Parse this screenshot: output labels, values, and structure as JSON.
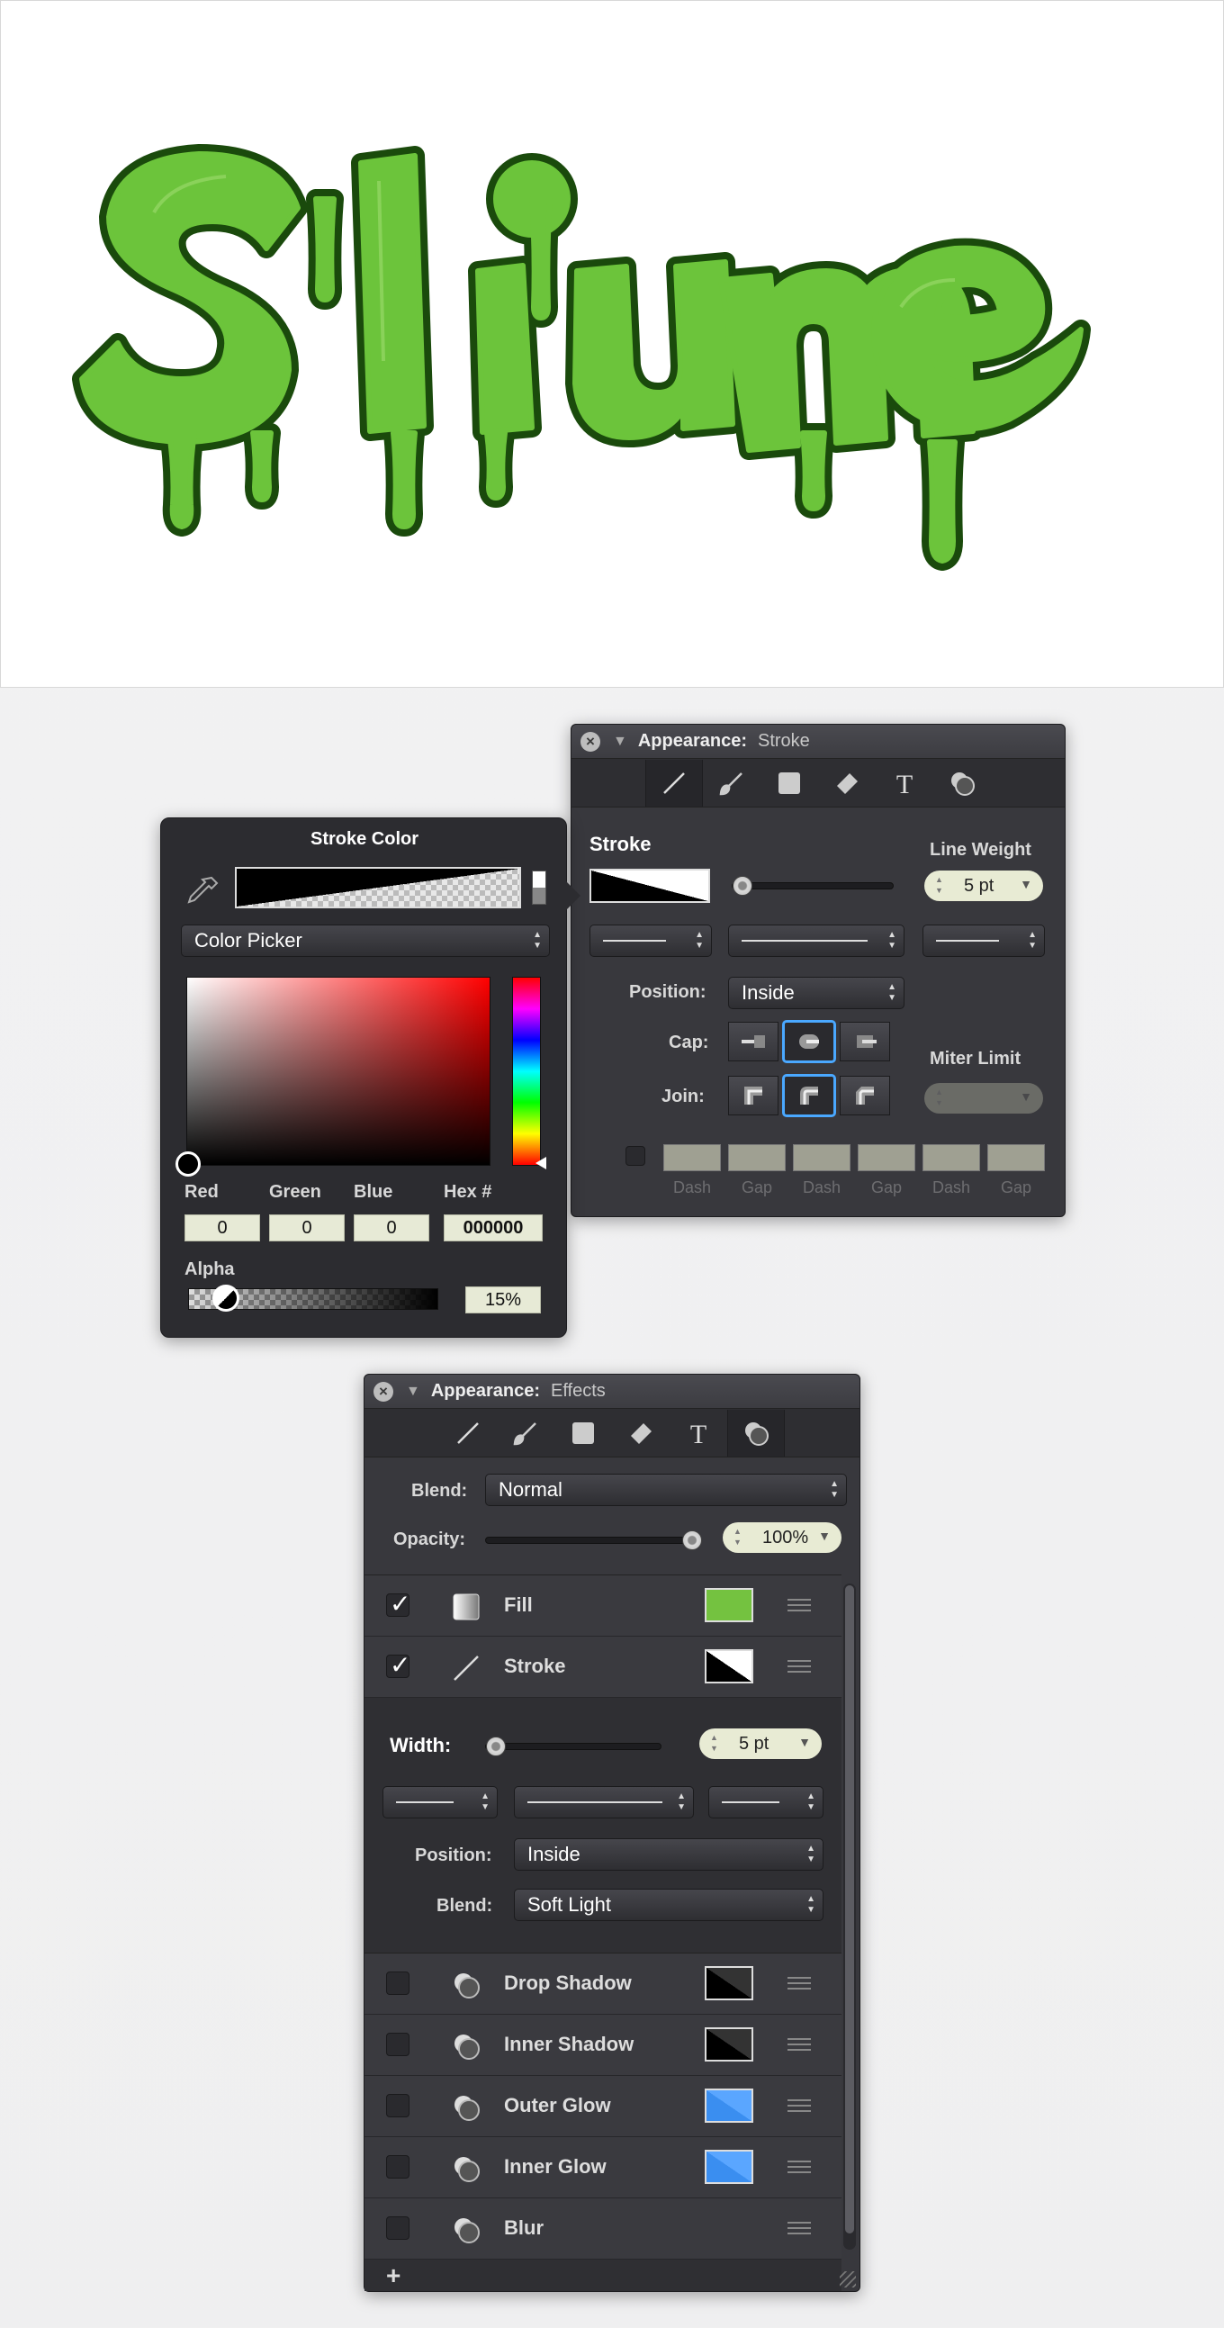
{
  "stroke_panel": {
    "title_bold": "Appearance:",
    "title_sub": "Stroke",
    "section_label": "Stroke",
    "line_weight_label": "Line Weight",
    "line_weight_value": "5 pt",
    "position_label": "Position:",
    "position_value": "Inside",
    "cap_label": "Cap:",
    "join_label": "Join:",
    "miter_label": "Miter Limit",
    "dash_labels": [
      "Dash",
      "Gap",
      "Dash",
      "Gap",
      "Dash",
      "Gap"
    ]
  },
  "color_popup": {
    "title": "Stroke Color",
    "mode_value": "Color Picker",
    "red_label": "Red",
    "red_value": "0",
    "green_label": "Green",
    "green_value": "0",
    "blue_label": "Blue",
    "blue_value": "0",
    "hex_label": "Hex #",
    "hex_value": "000000",
    "alpha_label": "Alpha",
    "alpha_value": "15%",
    "alpha_level": 0.15
  },
  "effects_panel": {
    "title_bold": "Appearance:",
    "title_sub": "Effects",
    "blend_label": "Blend:",
    "blend_value": "Normal",
    "opacity_label": "Opacity:",
    "opacity_value": "100%",
    "rows": [
      {
        "name": "Fill",
        "checked": true
      },
      {
        "name": "Stroke",
        "checked": true
      },
      {
        "name": "Drop Shadow",
        "checked": false
      },
      {
        "name": "Inner Shadow",
        "checked": false
      },
      {
        "name": "Outer Glow",
        "checked": false
      },
      {
        "name": "Inner Glow",
        "checked": false
      },
      {
        "name": "Blur",
        "checked": false
      }
    ],
    "width_label": "Width:",
    "width_value": "5 pt",
    "sub_position_label": "Position:",
    "sub_position_value": "Inside",
    "sub_blend_label": "Blend:",
    "sub_blend_value": "Soft Light",
    "add_label": "+"
  },
  "colors": {
    "slime_fill": "#6cc43b",
    "slime_outline": "#1a4a0c",
    "fill_swatch": "#74c240",
    "glow_swatch": "#3a8ef0",
    "selection_accent": "#4aa8ff"
  }
}
